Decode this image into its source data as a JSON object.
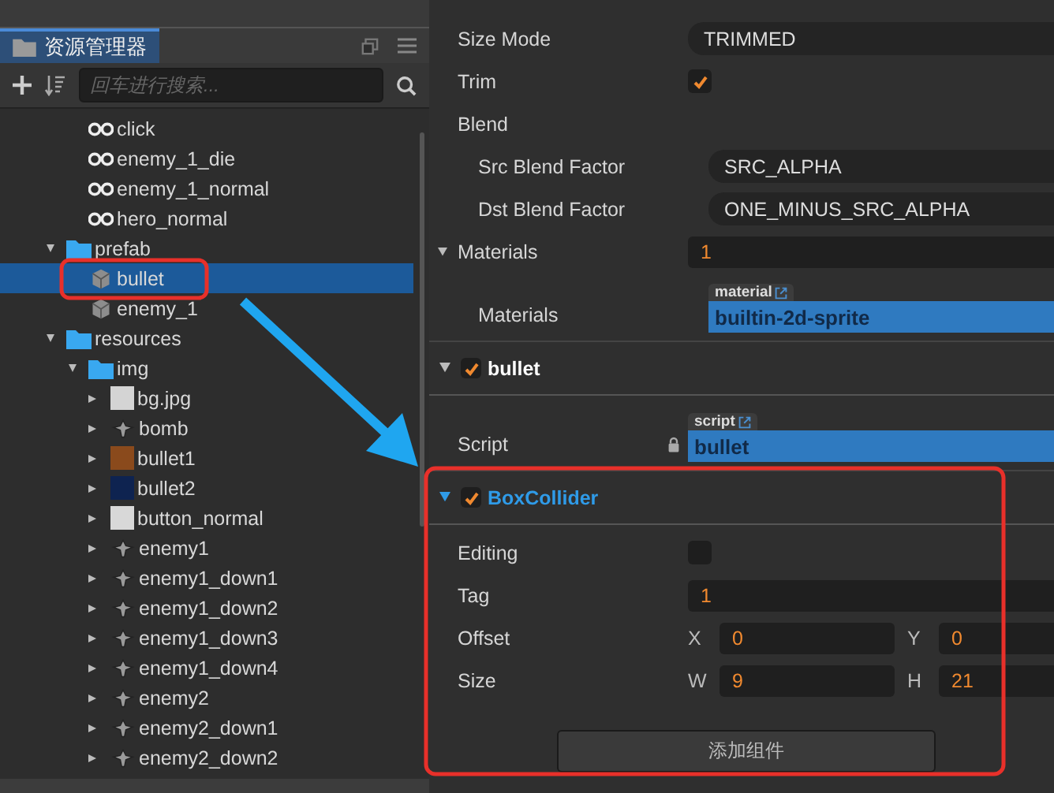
{
  "explorer": {
    "title": "资源管理器",
    "search": {
      "placeholder": "回车进行搜索..."
    },
    "tree": {
      "continued_items": [
        {
          "label": "click",
          "kind": "clip",
          "selected": false
        },
        {
          "label": "enemy_1_die",
          "kind": "clip",
          "selected": false
        },
        {
          "label": "enemy_1_normal",
          "kind": "clip",
          "selected": false
        },
        {
          "label": "hero_normal",
          "kind": "clip",
          "selected": false
        }
      ],
      "items": [
        {
          "label": "prefab",
          "kind": "folder",
          "selected": false,
          "expanded": true,
          "children": [
            {
              "label": "bullet",
              "kind": "prefab",
              "selected": true
            },
            {
              "label": "enemy_1",
              "kind": "prefab",
              "selected": false
            }
          ]
        },
        {
          "label": "resources",
          "kind": "folder",
          "selected": false,
          "expanded": true,
          "children": [
            {
              "label": "img",
              "kind": "folder",
              "selected": false,
              "expanded": true,
              "children": [
                {
                  "label": "bg.jpg",
                  "kind": "image",
                  "color": "#d4d4d4",
                  "selected": false,
                  "expanded": false
                },
                {
                  "label": "bomb",
                  "kind": "sprite",
                  "selected": false,
                  "expanded": false
                },
                {
                  "label": "bullet1",
                  "kind": "image",
                  "color": "#8a4a1c",
                  "selected": false,
                  "expanded": false
                },
                {
                  "label": "bullet2",
                  "kind": "image",
                  "color": "#0e2350",
                  "selected": false,
                  "expanded": false
                },
                {
                  "label": "button_normal",
                  "kind": "image",
                  "color": "#d8d8d8",
                  "selected": false,
                  "expanded": false
                },
                {
                  "label": "enemy1",
                  "kind": "sprite",
                  "selected": false,
                  "expanded": false
                },
                {
                  "label": "enemy1_down1",
                  "kind": "sprite",
                  "selected": false,
                  "expanded": false
                },
                {
                  "label": "enemy1_down2",
                  "kind": "sprite",
                  "selected": false,
                  "expanded": false
                },
                {
                  "label": "enemy1_down3",
                  "kind": "sprite",
                  "selected": false,
                  "expanded": false
                },
                {
                  "label": "enemy1_down4",
                  "kind": "sprite",
                  "selected": false,
                  "expanded": false
                },
                {
                  "label": "enemy2",
                  "kind": "sprite",
                  "selected": false,
                  "expanded": false
                },
                {
                  "label": "enemy2_down1",
                  "kind": "sprite",
                  "selected": false,
                  "expanded": false
                },
                {
                  "label": "enemy2_down2",
                  "kind": "sprite",
                  "selected": false,
                  "expanded": false
                }
              ]
            }
          ]
        }
      ]
    }
  },
  "inspector": {
    "rows": [
      {
        "kind": "select",
        "label": "Size Mode",
        "value": "TRIMMED"
      },
      {
        "kind": "checkbox",
        "label": "Trim",
        "checked": true
      },
      {
        "kind": "group",
        "label": "Blend",
        "children": [
          {
            "kind": "select",
            "label": "Src Blend Factor",
            "value": "SRC_ALPHA"
          },
          {
            "kind": "select",
            "label": "Dst Blend Factor",
            "value": "ONE_MINUS_SRC_ALPHA"
          }
        ]
      },
      {
        "kind": "array",
        "label": "Materials",
        "value": "1",
        "expanded": true,
        "children": [
          {
            "kind": "asset",
            "label": "Materials",
            "tag": "material",
            "value": "builtin-2d-sprite",
            "locked": false
          }
        ]
      },
      {
        "kind": "component",
        "title": "bullet",
        "enabled": true,
        "expanded": true,
        "color": "#ffffff"
      },
      {
        "kind": "asset",
        "label": "Script",
        "tag": "script",
        "value": "bullet",
        "locked": true
      },
      {
        "kind": "component",
        "title": "BoxCollider",
        "enabled": true,
        "expanded": true,
        "color": "#2f9be8"
      },
      {
        "kind": "checkbox",
        "label": "Editing",
        "checked": false
      },
      {
        "kind": "number",
        "label": "Tag",
        "value": "1"
      },
      {
        "kind": "vector",
        "label": "Offset",
        "fields": [
          {
            "axis": "X",
            "value": "0"
          },
          {
            "axis": "Y",
            "value": "0"
          }
        ]
      },
      {
        "kind": "vector",
        "label": "Size",
        "fields": [
          {
            "axis": "W",
            "value": "9"
          },
          {
            "axis": "H",
            "value": "21"
          }
        ]
      }
    ],
    "add_button": "添加组件"
  }
}
